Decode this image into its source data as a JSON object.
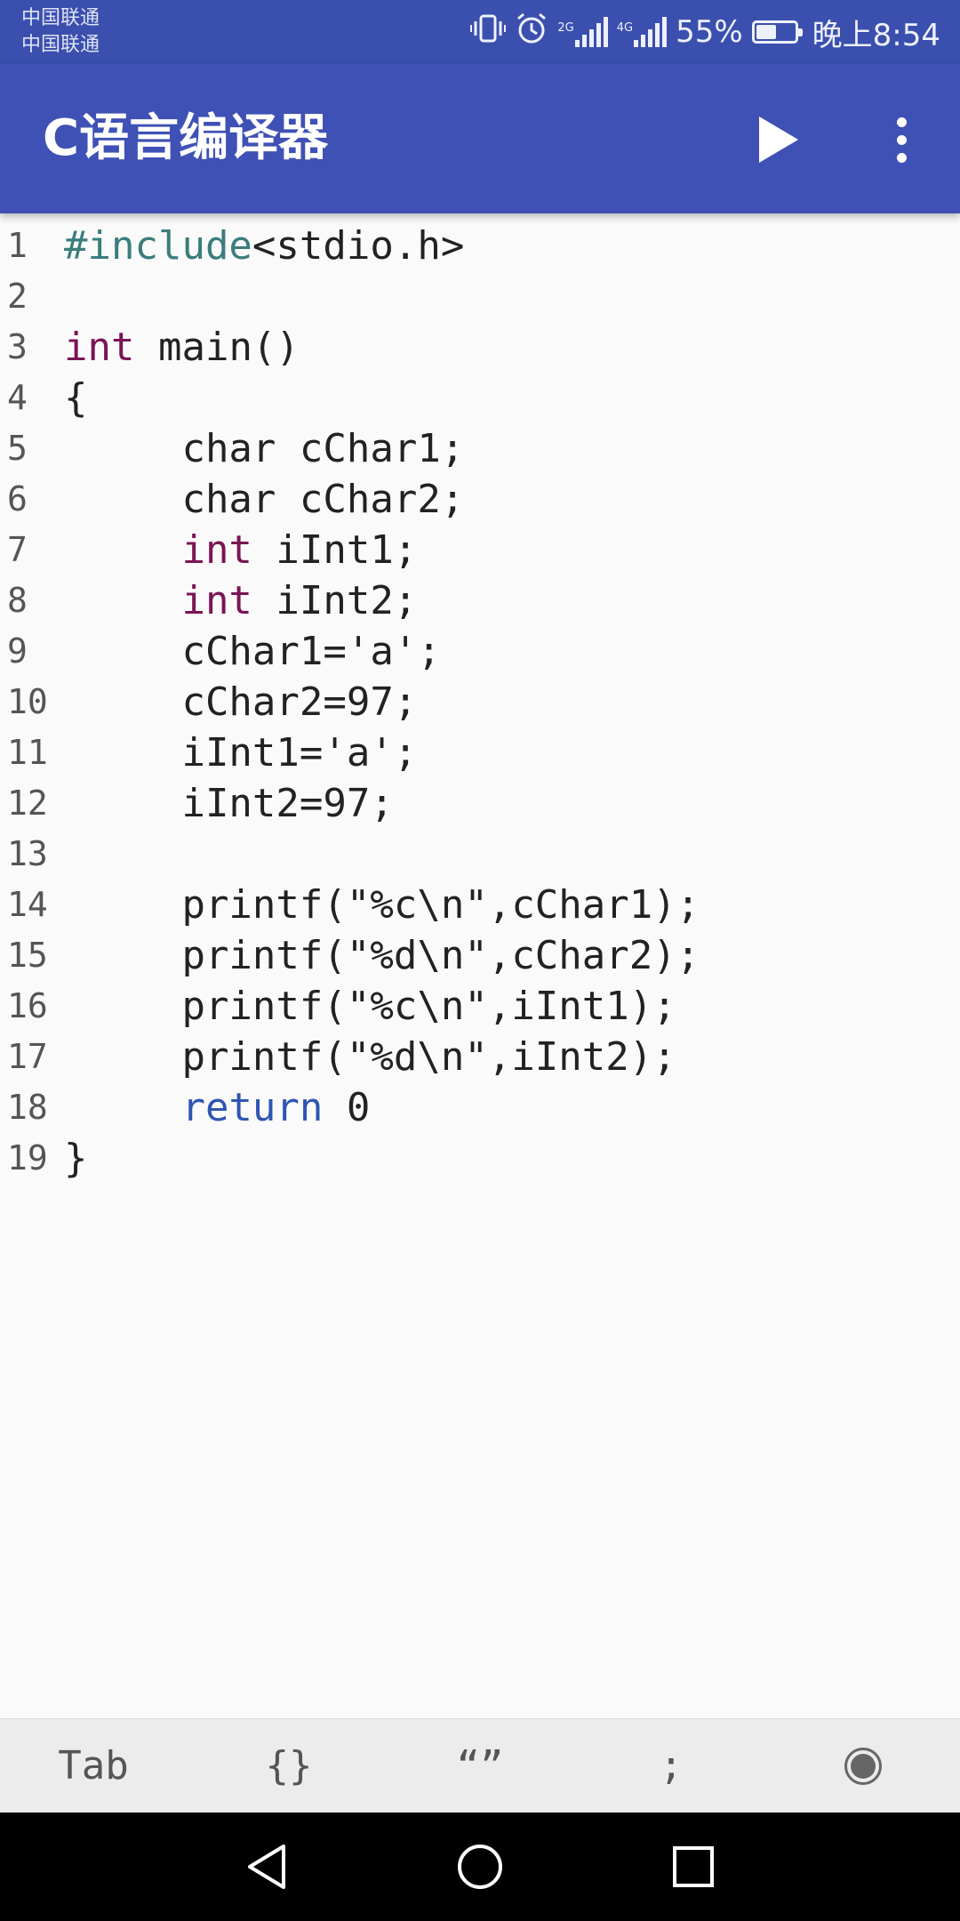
{
  "status_bar": {
    "carrier_1": "中国联通",
    "carrier_2": "中国联通",
    "network_2g": "2G",
    "network_4g": "4G",
    "battery_percent": "55%",
    "battery_level": 0.55,
    "time": "晚上8:54",
    "icons": [
      "vibrate-icon",
      "alarm-icon",
      "signal-icon",
      "battery-icon"
    ]
  },
  "app_bar": {
    "title": "C语言编译器",
    "actions": [
      "play-icon",
      "more-vert-icon"
    ],
    "background": "#3f51b5"
  },
  "editor": {
    "lines": [
      {
        "number": "1",
        "code": "#include<stdio.h>"
      },
      {
        "number": "2",
        "code": ""
      },
      {
        "number": "3",
        "code": "int main()"
      },
      {
        "number": "4",
        "code": "{"
      },
      {
        "number": "5",
        "code": "     char cChar1;"
      },
      {
        "number": "6",
        "code": "     char cChar2;"
      },
      {
        "number": "7",
        "code": "     int iInt1;"
      },
      {
        "number": "8",
        "code": "     int iInt2;"
      },
      {
        "number": "9",
        "code": "     cChar1='a';"
      },
      {
        "number": "10",
        "code": "     cChar2=97;"
      },
      {
        "number": "11",
        "code": "     iInt1='a';"
      },
      {
        "number": "12",
        "code": "     iInt2=97;"
      },
      {
        "number": "13",
        "code": ""
      },
      {
        "number": "14",
        "code": "     printf(\"%c\\n\",cChar1);"
      },
      {
        "number": "15",
        "code": "     printf(\"%d\\n\",cChar2);"
      },
      {
        "number": "16",
        "code": "     printf(\"%c\\n\",iInt1);"
      },
      {
        "number": "17",
        "code": "     printf(\"%d\\n\",iInt2);"
      },
      {
        "number": "18",
        "code": "     return 0"
      },
      {
        "number": "19",
        "code": "}"
      }
    ],
    "colors": {
      "preprocessor": "#3a7d7c",
      "keyword": "#7a1454",
      "return": "#2f55b3",
      "text": "#222222"
    }
  },
  "shortcut_bar": {
    "keys": [
      "Tab",
      "{}",
      "“”",
      ";"
    ],
    "last_icon": "record-icon"
  },
  "nav_bar": {
    "icons": [
      "back-icon",
      "home-icon",
      "recents-icon"
    ]
  }
}
